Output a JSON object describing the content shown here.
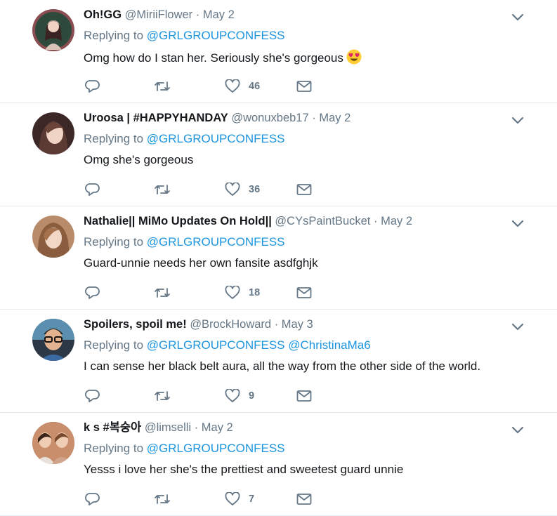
{
  "tweets": [
    {
      "name": "Oh!GG",
      "handle": "@MiriiFlower",
      "sep": "·",
      "date": "May 2",
      "replying_prefix": "Replying to",
      "mentions": [
        "@GRLGROUPCONFESS"
      ],
      "text": "Omg how do I stan her. Seriously she's gorgeous",
      "emoji": "heart-eyes-emoji",
      "likes": "46",
      "avatar_color": "#8a4e52"
    },
    {
      "name": "Uroosa | #HAPPYHANDAY",
      "handle": "@wonuxbeb17",
      "sep": "·",
      "date": "May 2",
      "replying_prefix": "Replying to",
      "mentions": [
        "@GRLGROUPCONFESS"
      ],
      "text": "Omg she's gorgeous",
      "likes": "36",
      "avatar_color": "#3a2726"
    },
    {
      "name": "Nathalie|| MiMo Updates On Hold||",
      "handle": "@CYsPaintBucket",
      "sep": "·",
      "date": "May 2",
      "replying_prefix": "Replying to",
      "mentions": [
        "@GRLGROUPCONFESS"
      ],
      "text": "Guard-unnie needs her own fansite asdfghjk",
      "likes": "18",
      "avatar_color": "#b88b6b"
    },
    {
      "name": "Spoilers, spoil me!",
      "handle": "@BrockHoward",
      "sep": "·",
      "date": "May 3",
      "replying_prefix": "Replying to",
      "mentions": [
        "@GRLGROUPCONFESS",
        "@ChristinaMa6"
      ],
      "text": "I can sense her black belt aura, all the way from the other side of the world.",
      "likes": "9",
      "avatar_color": "#2c3845"
    },
    {
      "name": "k s #복숭아",
      "handle": "@limselli",
      "sep": "·",
      "date": "May 2",
      "replying_prefix": "Replying to",
      "mentions": [
        "@GRLGROUPCONFESS"
      ],
      "text": "Yesss i love her she's the prettiest and sweetest guard unnie",
      "likes": "7",
      "avatar_color": "#a56a4f"
    }
  ],
  "icons": {
    "reply": "reply-icon",
    "retweet": "retweet-icon",
    "like": "heart-icon",
    "dm": "envelope-icon",
    "caret": "chevron-down-icon"
  },
  "colors": {
    "text": "#14171a",
    "secondary": "#657786",
    "link": "#1b95e0",
    "divider": "#e6ecf0"
  }
}
